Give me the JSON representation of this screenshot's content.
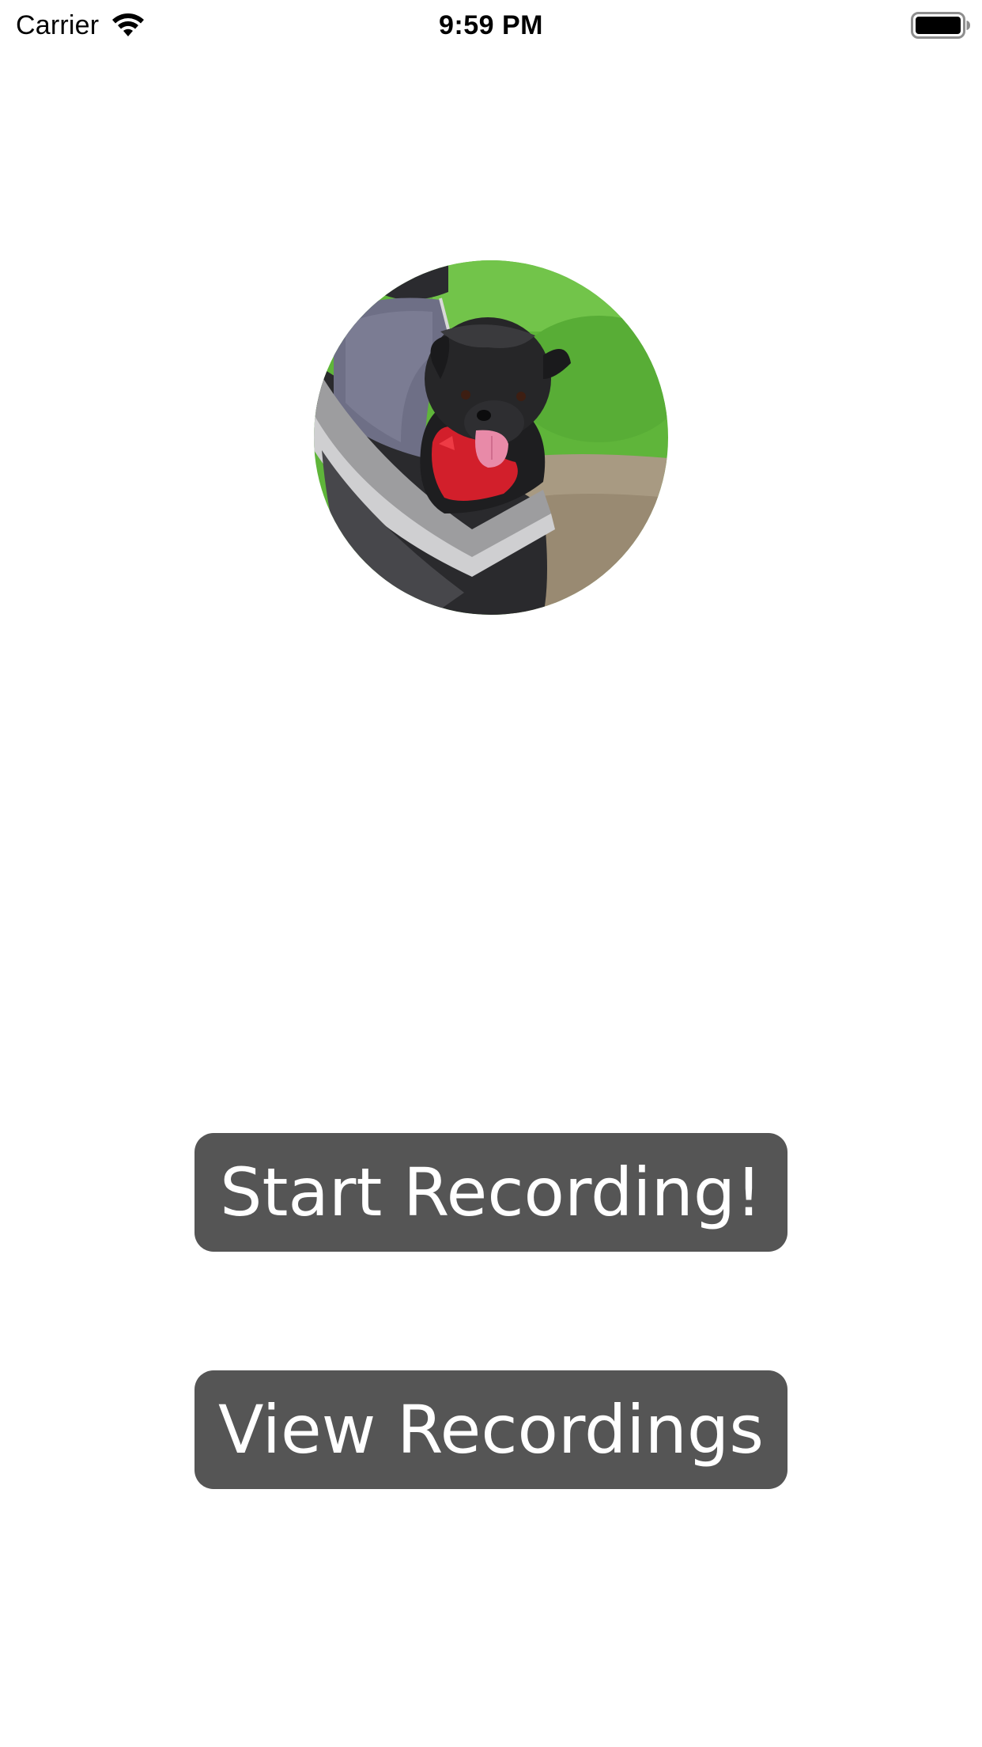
{
  "status_bar": {
    "carrier": "Carrier",
    "time": "9:59 PM",
    "icons": [
      "wifi-icon",
      "battery-icon"
    ]
  },
  "main": {
    "photo": {
      "alt": "dog-photo"
    },
    "buttons": {
      "start_label": "Start Recording!",
      "view_label": "View Recordings"
    }
  },
  "colors": {
    "background": "#ffffff",
    "button_background": "#555555",
    "button_text": "#ffffff"
  }
}
